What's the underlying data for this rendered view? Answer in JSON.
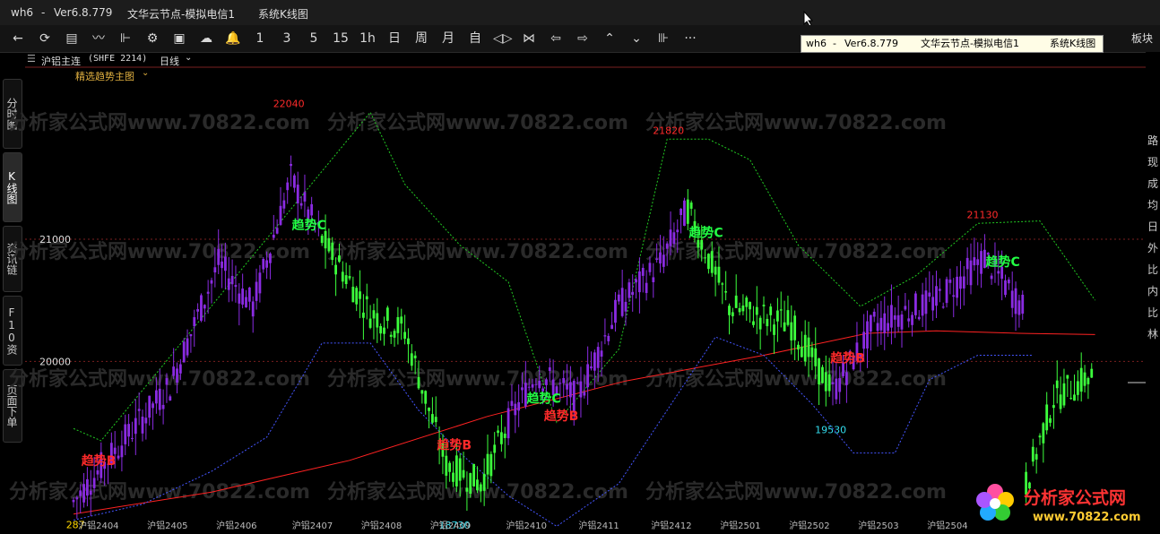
{
  "titlebar": {
    "app": "wh6",
    "sep": "-",
    "version": "Ver6.8.779",
    "node": "文华云节点-模拟电信1",
    "view": "系统K线图"
  },
  "tooltip": {
    "app": "wh6",
    "sep": "-",
    "version": "Ver6.8.779",
    "node": "文华云节点-模拟电信1",
    "view": "系统K线图"
  },
  "toolbar": {
    "items": [
      "←",
      "⟳",
      "▤",
      "〰",
      "⊩",
      "⚙",
      "▣",
      "☁",
      "🔔",
      "1",
      "3",
      "5",
      "15",
      "1h",
      "日",
      "周",
      "月",
      "自",
      "◁▷",
      "⋈",
      "⇦",
      "⇨",
      "⌃",
      "⌄",
      "⊪",
      "···"
    ],
    "bankuai": "板块"
  },
  "chart_header": {
    "symbol": "沪铝主连",
    "code": "(SHFE 2214)",
    "period": "日线",
    "indicator": "精选趋势主图"
  },
  "side_tabs": [
    "分时图",
    "K线图",
    "资讯链",
    "F10资料",
    "页面下单"
  ],
  "right_strip": [
    "路",
    "现",
    "成",
    "均",
    "日",
    "外",
    "比",
    "内",
    "比",
    "林"
  ],
  "colors": {
    "up": "#8a2be2",
    "down": "#3cff3c",
    "ma": "#ff2222",
    "support": "#4455ff",
    "resistance": "#22cc22",
    "label_up": "#ff2a2a",
    "label_down": "#22ff44",
    "grid": "#7a1f1f"
  },
  "watermark_text": "分析家公式网www.70822.com",
  "logo": {
    "name": "分析家公式网",
    "url": "www.70822.com"
  },
  "chart_data": {
    "type": "candlestick",
    "title": "沪铝主连 日线",
    "ylim": [
      18660,
      22240
    ],
    "yticks": [
      21000,
      20000
    ],
    "ytick_labels": [
      "21000",
      "20000"
    ],
    "xticks": [
      {
        "i": 6,
        "label": "沪铝2404"
      },
      {
        "i": 26,
        "label": "沪铝2405"
      },
      {
        "i": 46,
        "label": "沪铝2406"
      },
      {
        "i": 68,
        "label": "沪铝2407"
      },
      {
        "i": 88,
        "label": "沪铝2408"
      },
      {
        "i": 108,
        "label": "沪铝2409"
      },
      {
        "i": 130,
        "label": "沪铝2410"
      },
      {
        "i": 151,
        "label": "沪铝2411"
      },
      {
        "i": 172,
        "label": "沪铝2412"
      },
      {
        "i": 192,
        "label": "沪铝2501"
      },
      {
        "i": 212,
        "label": "沪铝2502"
      },
      {
        "i": 232,
        "label": "沪铝2503"
      },
      {
        "i": 252,
        "label": "沪铝2504"
      }
    ],
    "peaks": [
      {
        "i": 62,
        "label": "22040",
        "value": 22040
      },
      {
        "i": 172,
        "label": "21820",
        "value": 21820
      },
      {
        "i": 263,
        "label": "21130",
        "value": 21130
      }
    ],
    "troughs": [
      {
        "i": 2,
        "label": "287",
        "value": 18750
      },
      {
        "i": 110,
        "label": "18730",
        "value": 18730
      },
      {
        "i": 219,
        "label": "19530",
        "value": 19530
      }
    ],
    "signals": [
      {
        "i": 8,
        "label": "趋势B",
        "kind": "B",
        "value": 19150
      },
      {
        "i": 69,
        "label": "趋势C",
        "kind": "C",
        "value": 21080
      },
      {
        "i": 111,
        "label": "趋势B",
        "kind": "B",
        "value": 19280
      },
      {
        "i": 137,
        "label": "趋势C",
        "kind": "C",
        "value": 19660
      },
      {
        "i": 142,
        "label": "趋势B",
        "kind": "B",
        "value": 19520
      },
      {
        "i": 184,
        "label": "趋势C",
        "kind": "C",
        "value": 21020
      },
      {
        "i": 225,
        "label": "趋势B",
        "kind": "B",
        "value": 19990
      },
      {
        "i": 270,
        "label": "趋势C",
        "kind": "C",
        "value": 20780
      }
    ],
    "segments": [
      {
        "from": 0,
        "to": 10,
        "start": 18850,
        "end": 19200,
        "trend": "up"
      },
      {
        "from": 10,
        "to": 28,
        "start": 19200,
        "end": 19800,
        "trend": "up"
      },
      {
        "from": 28,
        "to": 42,
        "start": 19800,
        "end": 20800,
        "trend": "up"
      },
      {
        "from": 42,
        "to": 52,
        "start": 20800,
        "end": 20450,
        "trend": "up"
      },
      {
        "from": 52,
        "to": 63,
        "start": 20450,
        "end": 21500,
        "trend": "up"
      },
      {
        "from": 63,
        "to": 72,
        "start": 21500,
        "end": 21000,
        "trend": "up"
      },
      {
        "from": 72,
        "to": 86,
        "start": 21000,
        "end": 20400,
        "trend": "down"
      },
      {
        "from": 86,
        "to": 96,
        "start": 20400,
        "end": 20250,
        "trend": "down"
      },
      {
        "from": 96,
        "to": 108,
        "start": 20250,
        "end": 19150,
        "trend": "down"
      },
      {
        "from": 108,
        "to": 118,
        "start": 19150,
        "end": 19000,
        "trend": "down"
      },
      {
        "from": 118,
        "to": 126,
        "start": 19000,
        "end": 19500,
        "trend": "down"
      },
      {
        "from": 126,
        "to": 134,
        "start": 19500,
        "end": 19900,
        "trend": "up"
      },
      {
        "from": 134,
        "to": 146,
        "start": 19900,
        "end": 19700,
        "trend": "up"
      },
      {
        "from": 146,
        "to": 158,
        "start": 19700,
        "end": 20450,
        "trend": "up"
      },
      {
        "from": 158,
        "to": 170,
        "start": 20450,
        "end": 20800,
        "trend": "up"
      },
      {
        "from": 170,
        "to": 178,
        "start": 20800,
        "end": 21250,
        "trend": "up"
      },
      {
        "from": 178,
        "to": 190,
        "start": 21250,
        "end": 20450,
        "trend": "down"
      },
      {
        "from": 190,
        "to": 208,
        "start": 20450,
        "end": 20300,
        "trend": "down"
      },
      {
        "from": 208,
        "to": 220,
        "start": 20300,
        "end": 19750,
        "trend": "down"
      },
      {
        "from": 220,
        "to": 232,
        "start": 19750,
        "end": 20300,
        "trend": "up"
      },
      {
        "from": 232,
        "to": 250,
        "start": 20300,
        "end": 20500,
        "trend": "up"
      },
      {
        "from": 250,
        "to": 264,
        "start": 20500,
        "end": 20850,
        "trend": "up"
      },
      {
        "from": 264,
        "to": 276,
        "start": 20850,
        "end": 20400,
        "trend": "up"
      },
      {
        "from": 276,
        "to": 284,
        "start": 19000,
        "end": 19700,
        "trend": "down"
      },
      {
        "from": 284,
        "to": 296,
        "start": 19700,
        "end": 19900,
        "trend": "down"
      }
    ],
    "ma_line": [
      [
        0,
        18750
      ],
      [
        40,
        18930
      ],
      [
        80,
        19190
      ],
      [
        120,
        19550
      ],
      [
        160,
        19840
      ],
      [
        200,
        20050
      ],
      [
        230,
        20230
      ],
      [
        250,
        20250
      ],
      [
        274,
        20230
      ],
      [
        296,
        20220
      ]
    ],
    "support_line": [
      [
        0,
        18700
      ],
      [
        20,
        18830
      ],
      [
        40,
        19100
      ],
      [
        56,
        19380
      ],
      [
        72,
        20150
      ],
      [
        86,
        20150
      ],
      [
        100,
        19600
      ],
      [
        112,
        19250
      ],
      [
        126,
        18900
      ],
      [
        140,
        18650
      ],
      [
        158,
        19000
      ],
      [
        172,
        19600
      ],
      [
        186,
        20200
      ],
      [
        200,
        20050
      ],
      [
        214,
        19650
      ],
      [
        226,
        19250
      ],
      [
        238,
        19250
      ],
      [
        248,
        19850
      ],
      [
        262,
        20050
      ],
      [
        278,
        20050
      ]
    ],
    "resistance_line": [
      [
        0,
        19450
      ],
      [
        8,
        19350
      ],
      [
        86,
        22040
      ],
      [
        96,
        21450
      ],
      [
        112,
        20950
      ],
      [
        126,
        20650
      ],
      [
        140,
        19500
      ],
      [
        158,
        20100
      ],
      [
        172,
        21820
      ],
      [
        184,
        21820
      ],
      [
        196,
        21650
      ],
      [
        210,
        20950
      ],
      [
        228,
        20450
      ],
      [
        244,
        20700
      ],
      [
        262,
        21130
      ],
      [
        280,
        21150
      ],
      [
        296,
        20500
      ]
    ]
  }
}
